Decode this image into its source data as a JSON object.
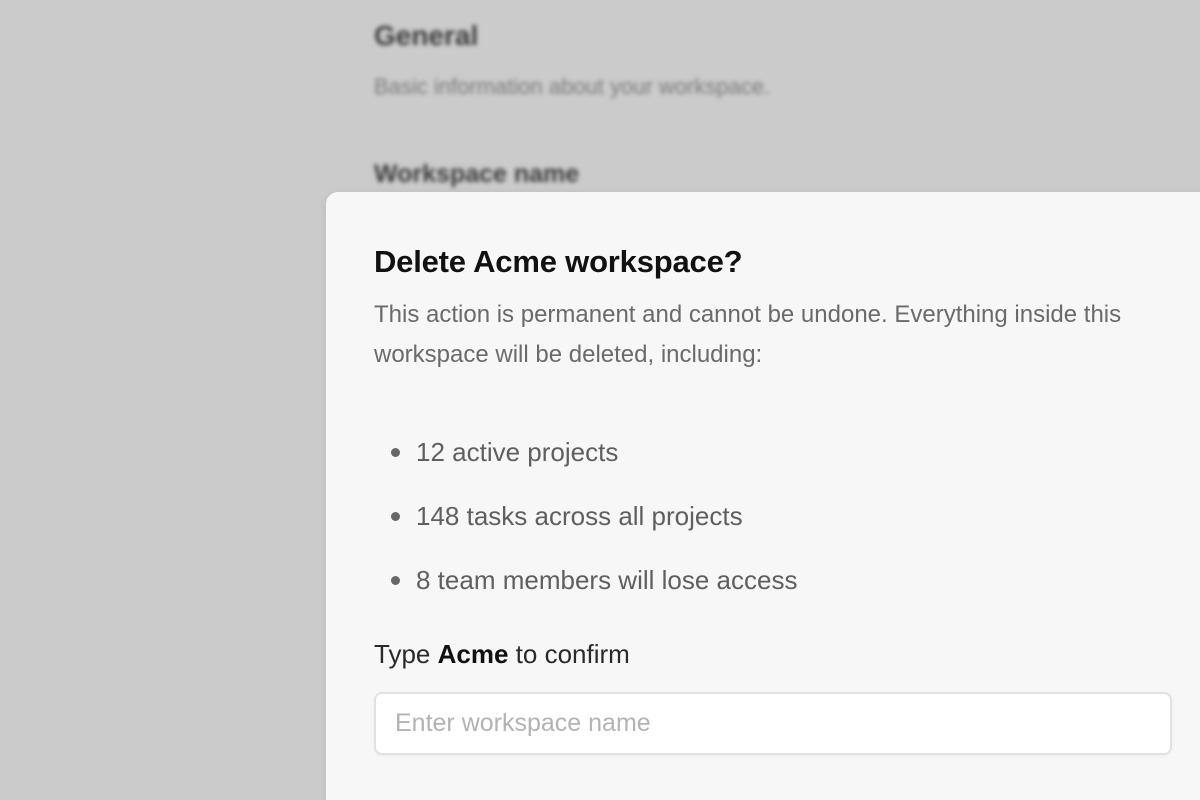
{
  "background": {
    "section_title": "General",
    "section_description": "Basic information about your workspace.",
    "field_label": "Workspace name"
  },
  "dialog": {
    "title": "Delete Acme workspace?",
    "description": "This action is permanent and cannot be undone. Everything inside this workspace will be deleted, including:",
    "consequences": [
      "12 active projects",
      "148 tasks across all projects",
      "8 team members will lose access"
    ],
    "confirm_prefix": "Type",
    "confirm_keyword": "Acme",
    "confirm_suffix": "to confirm",
    "input_placeholder": "Enter workspace name",
    "input_value": ""
  },
  "colors": {
    "overlay": "#cbcbcb",
    "dialog_background": "#f7f7f7",
    "title_text": "#111111",
    "body_text": "#6a6a6a",
    "input_border": "#e2e2e2",
    "placeholder": "#b3b3b3"
  }
}
